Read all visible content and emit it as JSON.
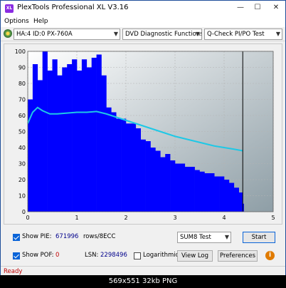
{
  "window": {
    "title": "PlexTools Professional XL V3.16"
  },
  "menu": {
    "options": "Options",
    "help": "Help"
  },
  "toolbar": {
    "drive": "HA:4 ID:0  PX-760A",
    "function": "DVD Diagnostic Functions",
    "test": "Q-Check  PI/PO Test"
  },
  "chart_data": {
    "type": "bar",
    "title": "",
    "xlabel": "",
    "ylabel": "",
    "xlim": [
      0,
      5
    ],
    "ylim": [
      0,
      100
    ],
    "x_ticks": [
      "0",
      "1",
      "2",
      "3",
      "4",
      "5"
    ],
    "y_ticks": [
      "0",
      "10",
      "20",
      "30",
      "40",
      "50",
      "60",
      "70",
      "80",
      "90",
      "100"
    ],
    "marker_x": 4.38,
    "series": [
      {
        "kind": "bars",
        "color": "#0000ff",
        "x": [
          0.0,
          0.1,
          0.2,
          0.3,
          0.4,
          0.5,
          0.6,
          0.7,
          0.8,
          0.9,
          1.0,
          1.1,
          1.2,
          1.3,
          1.4,
          1.5,
          1.6,
          1.7,
          1.8,
          1.9,
          2.0,
          2.1,
          2.2,
          2.3,
          2.4,
          2.5,
          2.6,
          2.7,
          2.8,
          2.9,
          3.0,
          3.1,
          3.2,
          3.3,
          3.4,
          3.5,
          3.6,
          3.7,
          3.8,
          3.9,
          4.0,
          4.1,
          4.2,
          4.3,
          4.38
        ],
        "values": [
          70,
          92,
          82,
          100,
          88,
          95,
          85,
          90,
          92,
          95,
          88,
          95,
          90,
          96,
          98,
          85,
          65,
          62,
          58,
          58,
          55,
          55,
          52,
          45,
          44,
          40,
          38,
          34,
          36,
          32,
          30,
          30,
          28,
          28,
          26,
          25,
          24,
          24,
          22,
          22,
          20,
          18,
          15,
          12,
          5
        ]
      },
      {
        "kind": "line",
        "color": "#1ec8e6",
        "x": [
          0.0,
          0.1,
          0.2,
          0.3,
          0.45,
          0.6,
          0.8,
          1.0,
          1.2,
          1.4,
          1.6,
          1.8,
          2.0,
          2.2,
          2.4,
          2.6,
          2.8,
          3.0,
          3.2,
          3.4,
          3.6,
          3.8,
          4.0,
          4.2,
          4.38
        ],
        "values": [
          55,
          62,
          65,
          63,
          61,
          61,
          61.5,
          62,
          62,
          62.5,
          61,
          59,
          57,
          55,
          53,
          51,
          49,
          47,
          45.5,
          44,
          42.5,
          41,
          40,
          39,
          38
        ]
      }
    ]
  },
  "controls": {
    "show_pie_label": "Show PIE:",
    "pie_value": "671996",
    "rows_label": "rows/8ECC",
    "test_mode": "SUM8 Test",
    "start_label": "Start",
    "show_pof_label": "Show POF:",
    "pof_value": "0",
    "lsn_label": "LSN:",
    "lsn_value": "2298496",
    "logarithmic_label": "Logarithmic",
    "view_log_label": "View Log",
    "preferences_label": "Preferences"
  },
  "status": {
    "text": "Ready"
  },
  "caption": {
    "text": "569x551  32kb  PNG"
  }
}
